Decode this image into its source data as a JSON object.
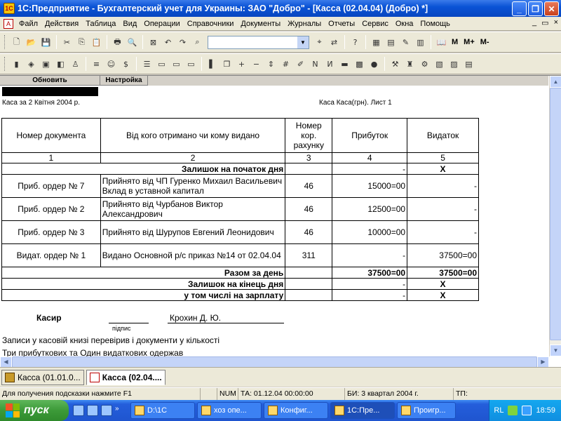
{
  "window": {
    "title": "1С:Предприятие - Бухгалтерский учет для Украины: ЗАО \"Добро\" - [Касса (02.04.04) (Добро)  *]"
  },
  "menu": {
    "items": [
      "Файл",
      "Действия",
      "Таблица",
      "Вид",
      "Операции",
      "Справочники",
      "Документы",
      "Журналы",
      "Отчеты",
      "Сервис",
      "Окна",
      "Помощь"
    ],
    "mdi_controls": [
      "_",
      "▭",
      "×"
    ]
  },
  "toolbar": {
    "labels": [
      "М",
      "М+",
      "М-"
    ],
    "search_value": ""
  },
  "report_tabs": {
    "refresh": "Обновить",
    "settings": "Настройка"
  },
  "report": {
    "title_left": "Каса за 2 Квітня 2004 р.",
    "title_right": "Каса Каса(грн). Лист 1",
    "headers": {
      "doc_number": "Номер документа",
      "from_to": "Від кого отримано чи кому видано",
      "corr_account": "Номер кор. рахунку",
      "income": "Прибуток",
      "expense": "Видаток"
    },
    "column_numbers": [
      "1",
      "2",
      "3",
      "4",
      "5"
    ],
    "opening_balance": {
      "label": "Залишок на початок дня",
      "income": "-",
      "expense": "X"
    },
    "rows": [
      {
        "doc": "Приб. ордер № 7",
        "desc": "Прийнято від ЧП Гуренко Михаил Васильевич Вклад в уставной капитал",
        "acc": "46",
        "income": "15000=00",
        "expense": "-"
      },
      {
        "doc": "Приб. ордер № 2",
        "desc": "Прийнято від Чурбанов Виктор Александрович",
        "acc": "46",
        "income": "12500=00",
        "expense": "-"
      },
      {
        "doc": "Приб. ордер № 3",
        "desc": "Прийнято від Шурупов Евгений Леонидович",
        "acc": "46",
        "income": "10000=00",
        "expense": "-"
      },
      {
        "doc": "Видат. ордер № 1",
        "desc": "Видано Основной р/с приказ №14 от 02.04.04",
        "acc": "311",
        "income": "-",
        "expense": "37500=00"
      }
    ],
    "day_total": {
      "label": "Разом за день",
      "income": "37500=00",
      "expense": "37500=00"
    },
    "closing_balance": {
      "label": "Залишок на кінець  дня",
      "income": "-",
      "expense": "X"
    },
    "salary": {
      "label": "у том числі на зарплату",
      "income": "-",
      "expense": "X"
    },
    "cashier_label": "Касир",
    "cashier_name": "Крохин Д. Ю.",
    "signature_label": "підпис",
    "footer_line1": "Записи у касовій книзі перевірив і документи у кількості",
    "footer_line2": "Три прибуткових та Один видаткових одержав"
  },
  "window_tabs": [
    {
      "label": "Касса (01.01.0..."
    },
    {
      "label": "Касса (02.04...."
    }
  ],
  "statusbar": {
    "hint": "Для получения подсказки нажмите F1",
    "num": "NUM",
    "ta": "ТА: 01.12.04  00:00:00",
    "bi": "БИ: 3 квартал 2004 г.",
    "tp": "ТП:"
  },
  "taskbar": {
    "start": "пуск",
    "tasks": [
      "D:\\1C",
      "хоз опе...",
      "Конфиг...",
      "1С:Пре...",
      "Проигр..."
    ],
    "active_task_index": 3,
    "language": "RL",
    "clock": "18:59"
  },
  "colors": {
    "titlebar": "#0a53d6",
    "taskbar": "#245edb",
    "start": "#3c9a38",
    "tray": "#0f8ee0"
  }
}
